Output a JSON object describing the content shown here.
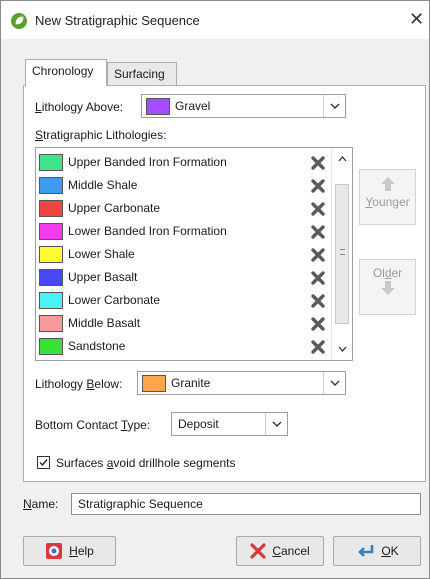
{
  "window": {
    "title": "New Stratigraphic Sequence",
    "close_glyph": "✕"
  },
  "tabs": [
    {
      "label": "Chronology",
      "active": true
    },
    {
      "label": "Surfacing",
      "active": false
    }
  ],
  "lithology_above": {
    "label_pre": "",
    "label_underlined": "L",
    "label_post": "ithology Above:",
    "value": "Gravel",
    "color": "#a64dff"
  },
  "strat_list": {
    "label_pre": "",
    "label_underlined": "S",
    "label_post": "tratigraphic Lithologies:",
    "items": [
      {
        "name": "Upper Banded Iron Formation",
        "color": "#3fe38a"
      },
      {
        "name": "Middle Shale",
        "color": "#3f9bf0"
      },
      {
        "name": "Upper Carbonate",
        "color": "#f04545"
      },
      {
        "name": "Lower Banded Iron Formation",
        "color": "#f03cf0"
      },
      {
        "name": "Lower Shale",
        "color": "#fbfb30"
      },
      {
        "name": "Upper Basalt",
        "color": "#4848f5"
      },
      {
        "name": "Lower Carbonate",
        "color": "#48f3f3"
      },
      {
        "name": "Middle Basalt",
        "color": "#f79a9a"
      },
      {
        "name": "Sandstone",
        "color": "#36e336"
      }
    ]
  },
  "buttons_side": {
    "younger_pre": "",
    "younger_underlined": "Y",
    "younger_post": "ounger",
    "older_pre": "Ol",
    "older_underlined": "d",
    "older_post": "er"
  },
  "lithology_below": {
    "label_pre": "Lithology ",
    "label_underlined": "B",
    "label_post": "elow:",
    "value": "Granite",
    "color": "#ffa64d"
  },
  "bottom_contact": {
    "label_pre": "Bottom Contact ",
    "label_underlined": "T",
    "label_post": "ype:",
    "value": "Deposit"
  },
  "avoid_drillhole": {
    "checked": true,
    "label_pre": "Surfaces ",
    "label_underlined": "a",
    "label_post": "void drillhole segments"
  },
  "name_field": {
    "label_pre": "",
    "label_underlined": "N",
    "label_post": "ame:",
    "value": "Stratigraphic Sequence"
  },
  "footer": {
    "help_pre": "",
    "help_underlined": "H",
    "help_post": "elp",
    "cancel_pre": "",
    "cancel_underlined": "C",
    "cancel_post": "ancel",
    "ok_pre": "",
    "ok_underlined": "O",
    "ok_post": "K"
  },
  "colors": {
    "accent": "#3c7fb1",
    "delete_icon": "#5a5a5a"
  }
}
